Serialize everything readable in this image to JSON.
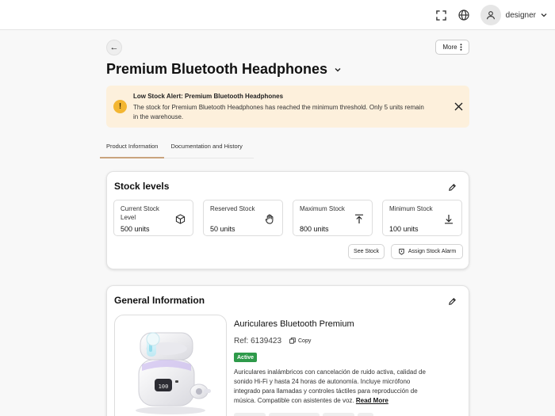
{
  "topbar": {
    "user_name": "designer"
  },
  "header": {
    "back_label": "←",
    "more_label": "More",
    "title": "Premium Bluetooth Headphones"
  },
  "alert": {
    "title": "Low Stock Alert: Premium Bluetooth Headphones",
    "text": "The stock for Premium Bluetooth Headphones has reached the minimum threshold. Only 5 units remain in the warehouse."
  },
  "tabs": [
    {
      "label": "Product Information",
      "active": true
    },
    {
      "label": "Documentation and History",
      "active": false
    }
  ],
  "stock": {
    "title": "Stock levels",
    "items": [
      {
        "label": "Current Stock Level",
        "value": "500 units",
        "icon": "cube-icon"
      },
      {
        "label": "Reserved Stock",
        "value": "50 units",
        "icon": "hand-icon"
      },
      {
        "label": "Maximum Stock",
        "value": "800 units",
        "icon": "arrow-up-icon"
      },
      {
        "label": "Minimum Stock",
        "value": "100 units",
        "icon": "arrow-down-icon"
      }
    ],
    "see_stock_label": "See Stock",
    "assign_alarm_label": "Assign Stock Alarm"
  },
  "general": {
    "title": "General Information",
    "product_name": "Auriculares Bluetooth Premium",
    "ref": "Ref: 6139423",
    "copy_label": "Copy",
    "status": "Active",
    "description": "Auriculares inalámbricos con cancelación de ruido activa, calidad de sonido Hi-Fi y hasta 24 horas de autonomía. Incluye micrófono integrado para llamadas y controles táctiles para reproducción de música. Compatible con asistentes de voz.",
    "read_more_label": "Read More",
    "case_display": "100"
  },
  "colors": {
    "accent": "#c9a47e",
    "alert_bg": "#fdf0dc",
    "alert_icon": "#f3b632",
    "status_green": "#2e9a4a"
  }
}
